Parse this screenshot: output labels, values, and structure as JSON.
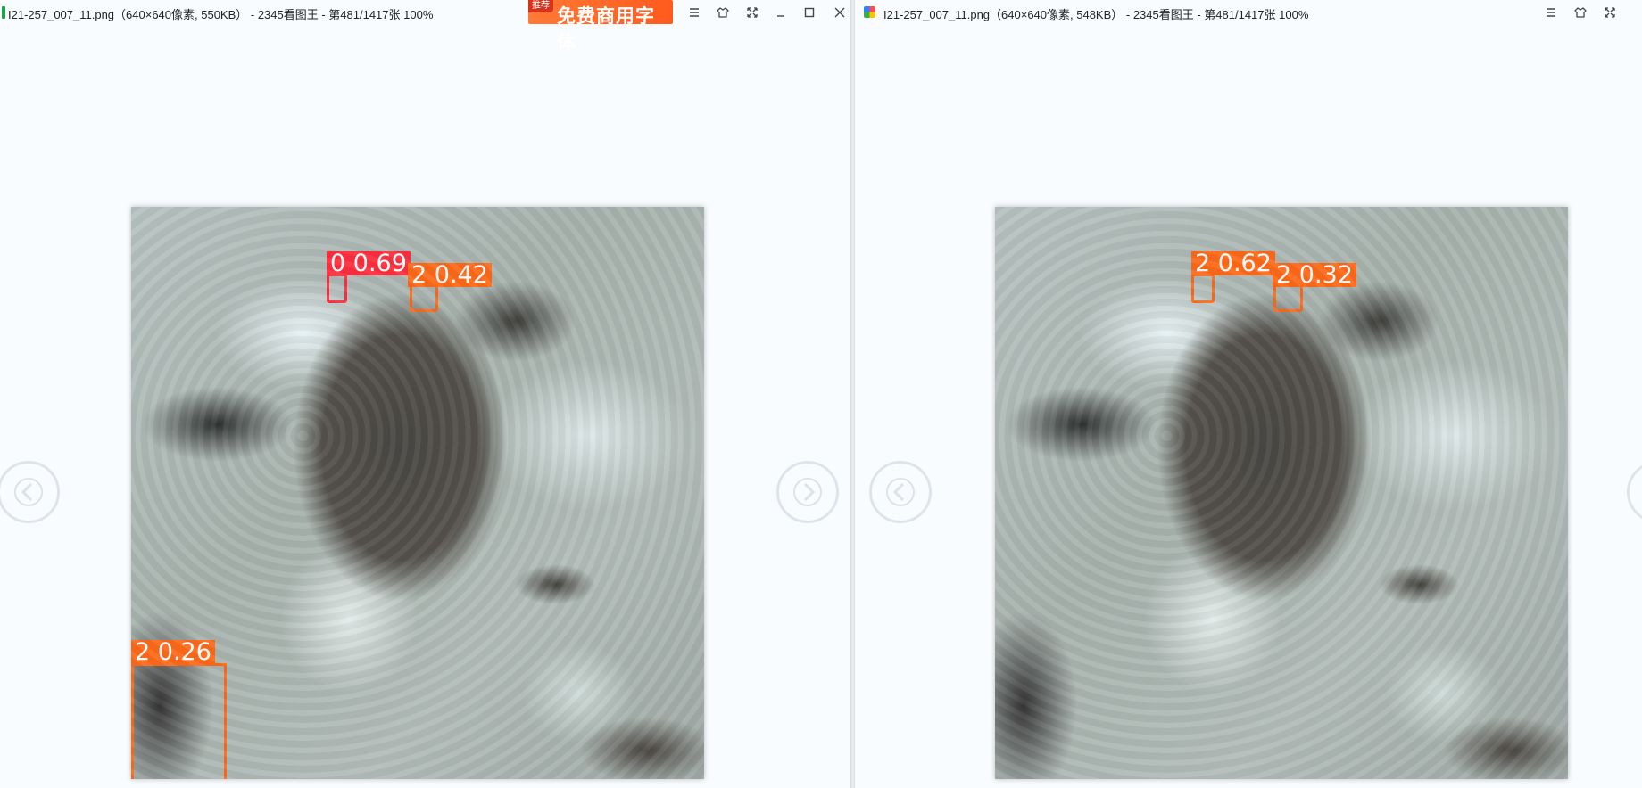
{
  "left_viewer": {
    "title": "I21-257_007_11.png（640×640像素, 550KB） - 2345看图王 - 第481/1417张 100%",
    "ad": {
      "tag": "推荐",
      "text": "免费商用字体"
    },
    "buttons": [
      "menu-icon",
      "skin-icon",
      "fullscreen-icon",
      "minimize-icon",
      "maximize-icon",
      "close-icon"
    ],
    "detections": [
      {
        "label": "0 0.69",
        "class_color": "#ff2f3e"
      },
      {
        "label": "2 0.42",
        "class_color": "#ff6a1a"
      },
      {
        "label": "2 0.26",
        "class_color": "#ff6a1a"
      }
    ]
  },
  "right_viewer": {
    "title": "I21-257_007_11.png（640×640像素, 548KB） - 2345看图王 - 第481/1417张 100%",
    "buttons": [
      "menu-icon",
      "skin-icon",
      "fullscreen-icon"
    ],
    "detections": [
      {
        "label": "2 0.62",
        "class_color": "#ff6a1a"
      },
      {
        "label": "2 0.32",
        "class_color": "#ff6a1a"
      }
    ]
  }
}
